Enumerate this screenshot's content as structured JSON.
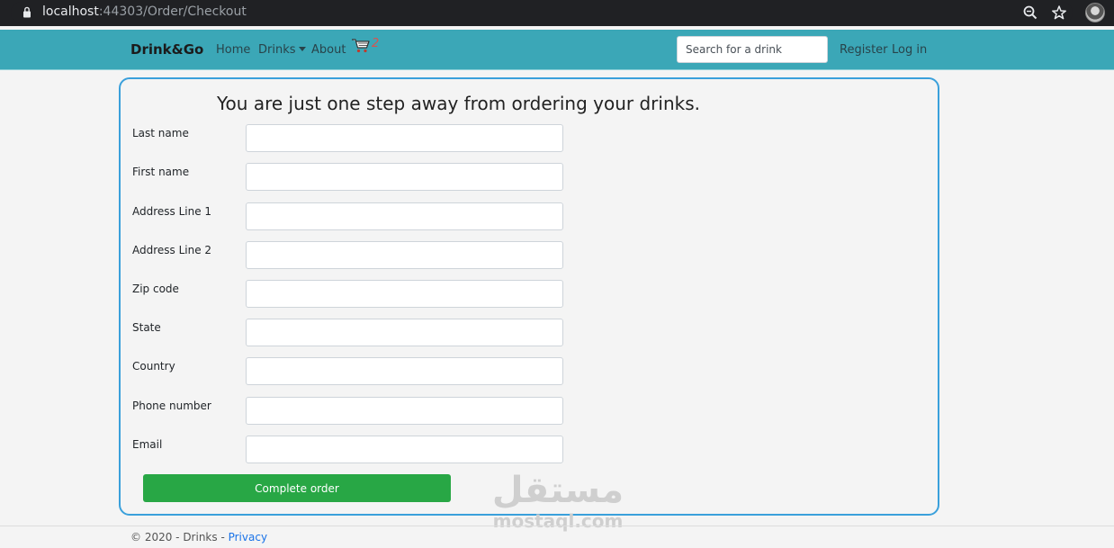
{
  "browser": {
    "url_host": "localhost",
    "url_rest": ":44303/Order/Checkout"
  },
  "navbar": {
    "brand": "Drink&Go",
    "links": {
      "home": "Home",
      "drinks": "Drinks",
      "about": "About"
    },
    "cart_count": "2",
    "search_placeholder": "Search for a drink",
    "register": "Register",
    "login": "Log in",
    "background_color": "#3ba7b7"
  },
  "checkout": {
    "title": "You are just one step away from ordering your drinks.",
    "fields": [
      {
        "label": "Last name",
        "value": ""
      },
      {
        "label": "First name",
        "value": ""
      },
      {
        "label": "Address Line 1",
        "value": ""
      },
      {
        "label": "Address Line 2",
        "value": ""
      },
      {
        "label": "Zip code",
        "value": ""
      },
      {
        "label": "State",
        "value": ""
      },
      {
        "label": "Country",
        "value": ""
      },
      {
        "label": "Phone number",
        "value": ""
      },
      {
        "label": "Email",
        "value": ""
      }
    ],
    "submit_label": "Complete order",
    "border_color": "#3aa0db",
    "button_color": "#28a745"
  },
  "watermark": {
    "arabic": "مستقل",
    "latin": "mostaql.com"
  },
  "footer": {
    "text": "© 2020 - Drinks - ",
    "privacy": "Privacy"
  }
}
